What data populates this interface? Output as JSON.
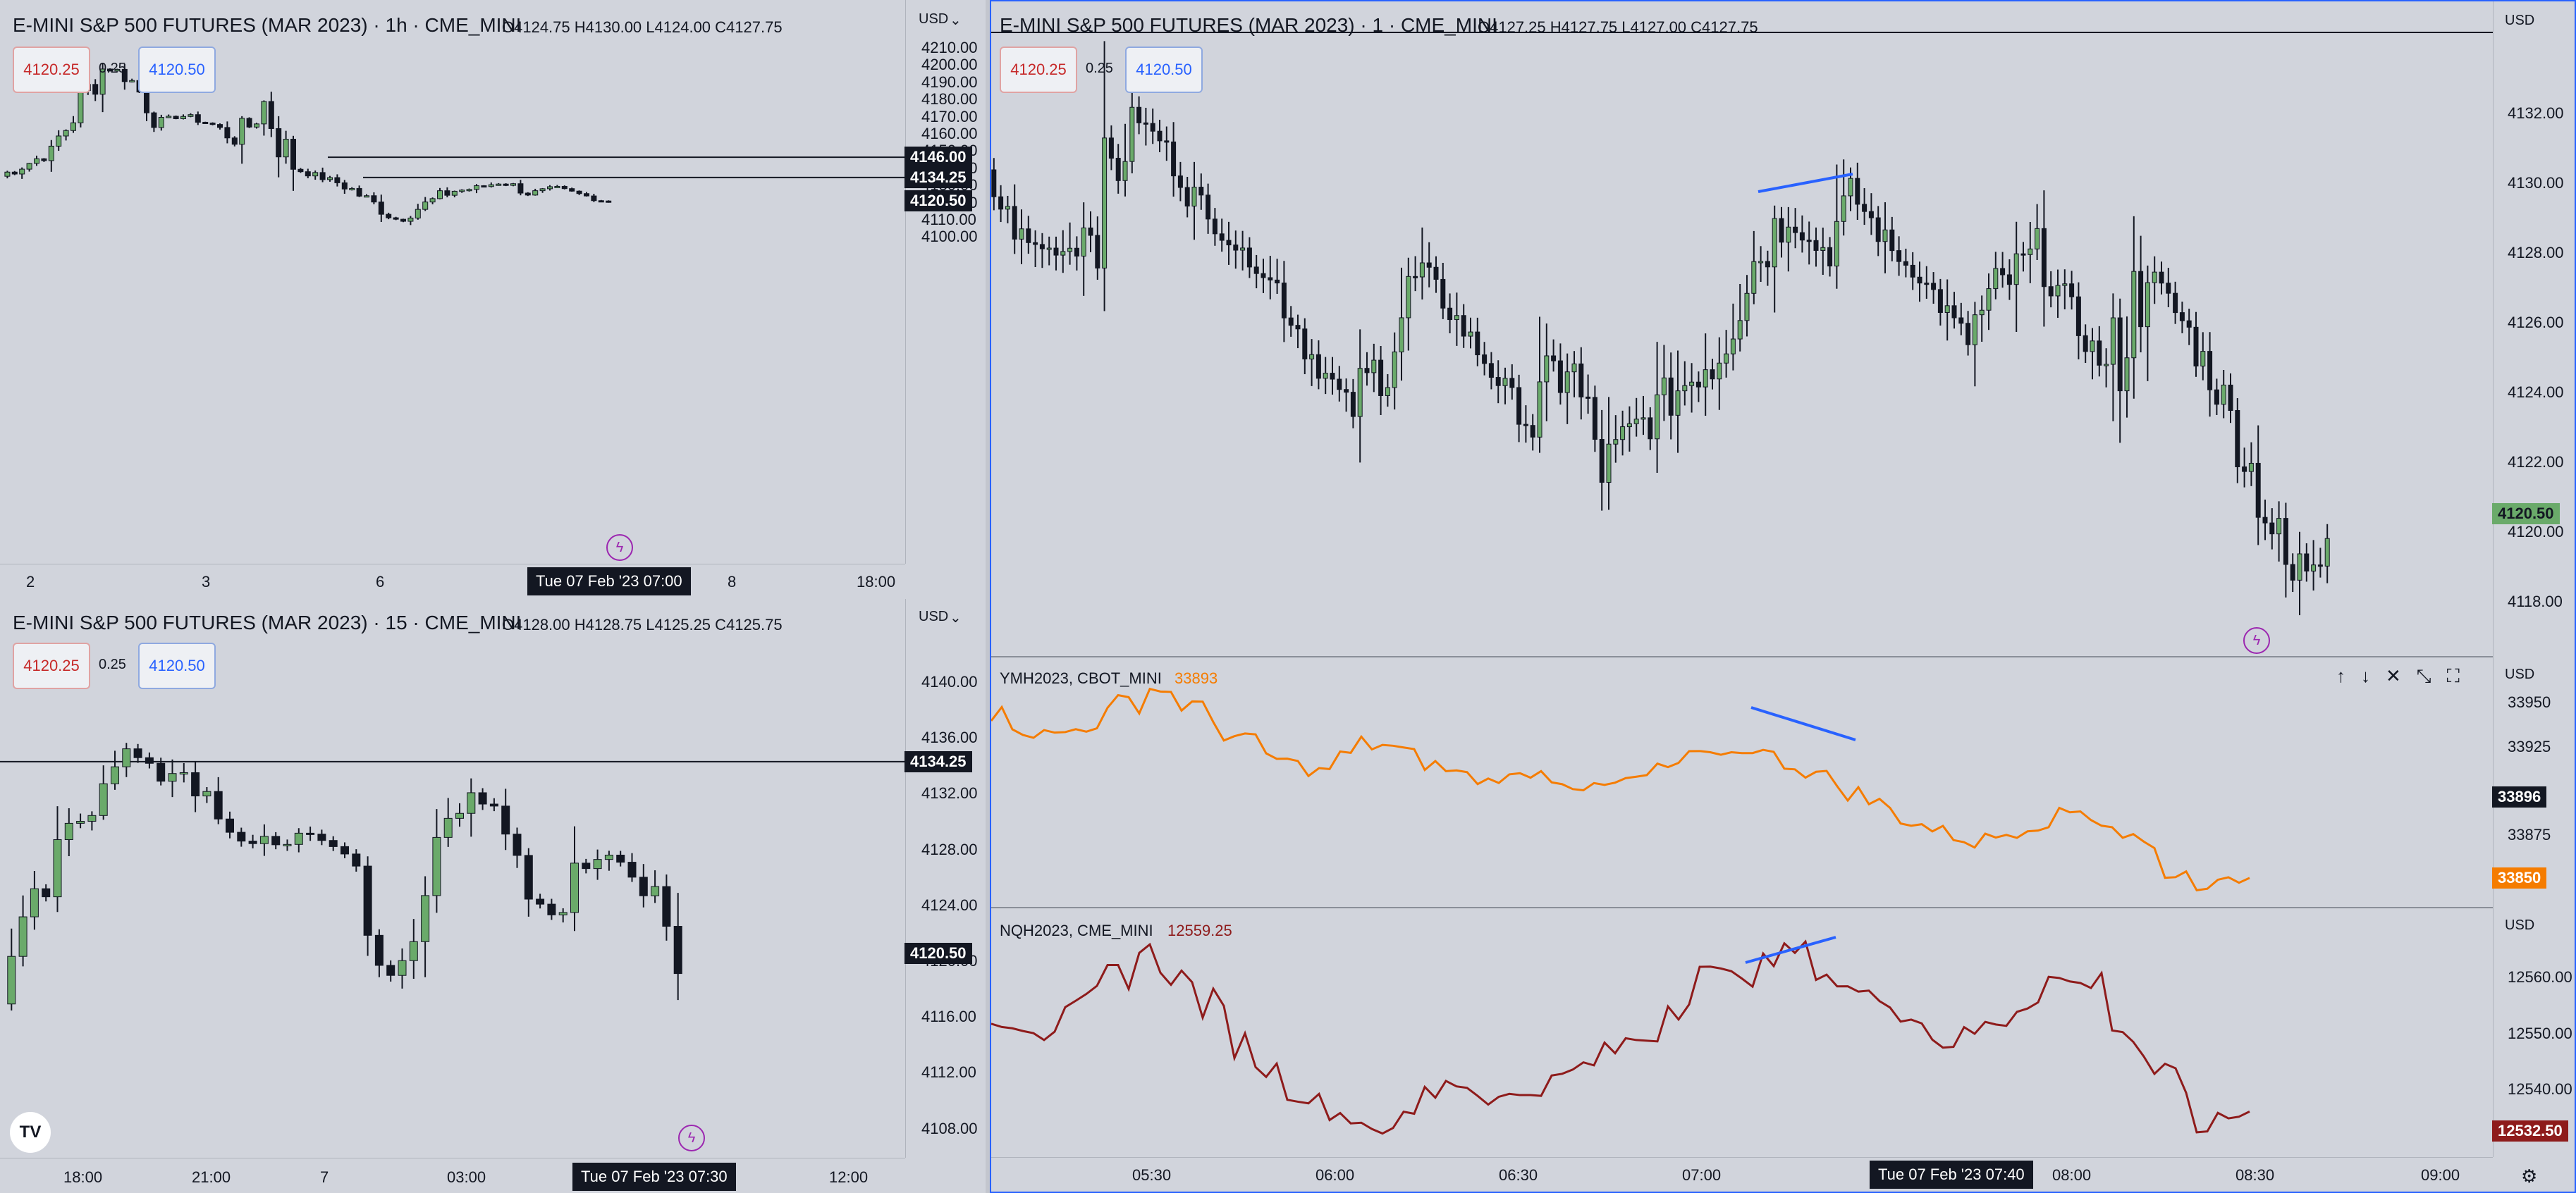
{
  "colors": {
    "up": "#6aaa6a",
    "down": "#131722",
    "accent": "#2962ff",
    "orange": "#f57c00",
    "darkred": "#8e1b1b",
    "sell": "#c62828"
  },
  "pane_tl": {
    "title": "E-MINI S&P 500 FUTURES (MAR 2023) · 1h · CME_MINI",
    "ohlc": "O4124.75 H4130.00 L4124.00 C4127.75",
    "sell": "4120.25",
    "spread": "0.25",
    "buy": "4120.50",
    "currency": "USD",
    "price_ticks": [
      "4210.00",
      "4200.00",
      "4190.00",
      "4180.00",
      "4170.00",
      "4160.00",
      "4150.00",
      "4140.00",
      "4130.00",
      "4120.00",
      "4110.00",
      "4100.00"
    ],
    "tags": [
      "4146.00",
      "4134.25",
      "4120.50"
    ],
    "time_ticks": [
      "2",
      "3",
      "6",
      "8",
      "18:00"
    ],
    "time_tag": "Tue 07 Feb '23   07:00"
  },
  "pane_bl": {
    "title": "E-MINI S&P 500 FUTURES (MAR 2023) · 15 · CME_MINI",
    "ohlc": "O4128.00 H4128.75 L4125.25 C4125.75",
    "sell": "4120.25",
    "spread": "0.25",
    "buy": "4120.50",
    "currency": "USD",
    "price_ticks": [
      "4140.00",
      "4136.00",
      "4132.00",
      "4128.00",
      "4124.00",
      "4120.00",
      "4116.00",
      "4112.00",
      "4108.00"
    ],
    "tags": [
      "4134.25",
      "4120.50"
    ],
    "time_ticks": [
      "18:00",
      "21:00",
      "7",
      "03:00",
      "12:00"
    ],
    "time_tag": "Tue 07 Feb '23   07:30",
    "logo": "TV"
  },
  "pane_main": {
    "title": "E-MINI S&P 500 FUTURES (MAR 2023) · 1 · CME_MINI",
    "ohlc": "O4127.25 H4127.75 L4127.00 C4127.75",
    "sell": "4120.25",
    "spread": "0.25",
    "buy": "4120.50",
    "currency": "USD",
    "price_ticks": [
      "4132.00",
      "4130.00",
      "4128.00",
      "4126.00",
      "4124.00",
      "4122.00",
      "4120.00",
      "4118.00"
    ],
    "tag": "4120.50"
  },
  "pane_ym": {
    "symbol": "YMH2023, CBOT_MINI",
    "value": "33893",
    "currency": "USD",
    "price_ticks": [
      "33950",
      "33925",
      "33875"
    ],
    "tags": [
      "33896",
      "33850"
    ]
  },
  "pane_nq": {
    "symbol": "NQH2023, CME_MINI",
    "value": "12559.25",
    "currency": "USD",
    "price_ticks": [
      "12560.00",
      "12550.00",
      "12540.00"
    ],
    "tag": "12532.50"
  },
  "time_axis": {
    "ticks": [
      "05:30",
      "06:00",
      "06:30",
      "07:00",
      "08:00",
      "08:30",
      "09:00"
    ],
    "time_tag": "Tue 07 Feb '23   07:40"
  },
  "pane_controls": [
    "up-arrow",
    "down-arrow",
    "close",
    "collapse",
    "maximize"
  ]
}
